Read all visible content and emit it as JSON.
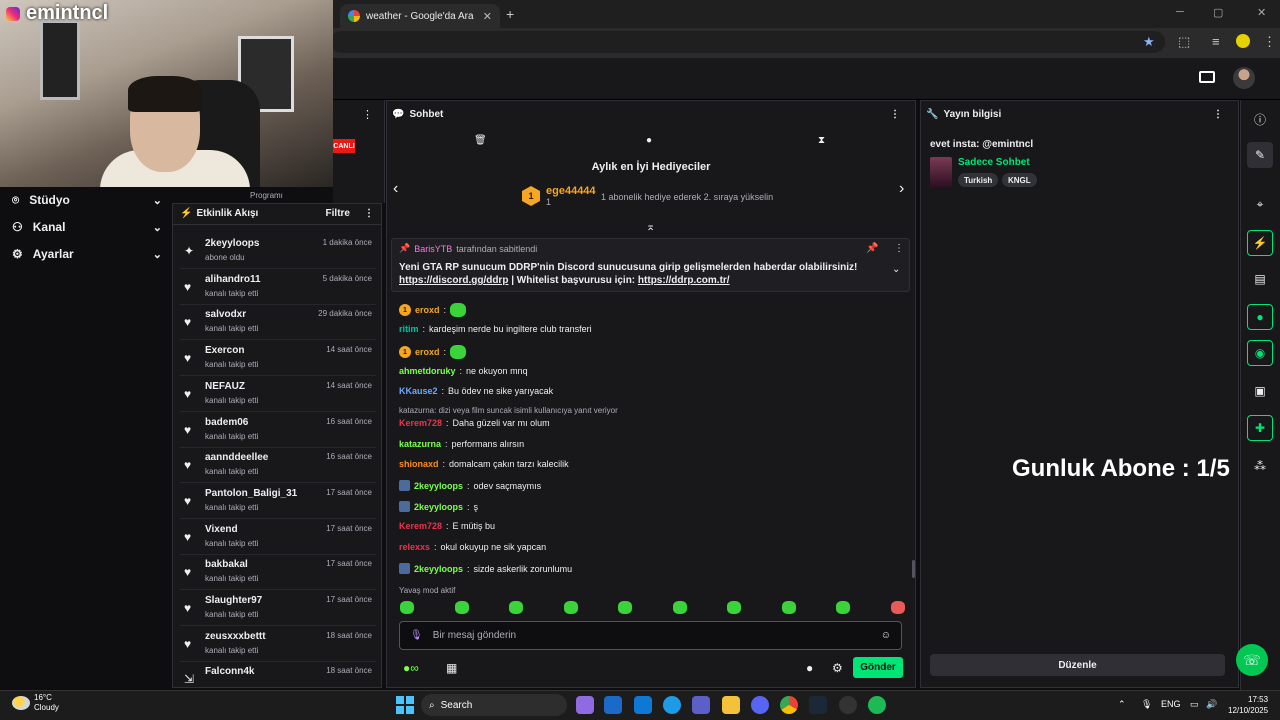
{
  "browser": {
    "tab_title": "weather - Google'da Ara",
    "tab_close": "✕",
    "new_tab": "+",
    "bookmark_star": "★",
    "win_controls": [
      "─",
      "▢",
      "✕"
    ]
  },
  "webcam": {
    "channel_name": "emintncl"
  },
  "left_nav": {
    "items": [
      {
        "icon": "studio-icon",
        "label": "Stüdyo"
      },
      {
        "icon": "channel-icon",
        "label": "Kanal"
      },
      {
        "icon": "settings-icon",
        "label": "Ayarlar"
      }
    ]
  },
  "sliver": {
    "live_badge": "CANLI",
    "text_fragments": [
      "Programı"
    ]
  },
  "activity_feed": {
    "title": "Etkinlik Akışı",
    "filter_label": "Filtre",
    "items": [
      {
        "icon": "star-icon",
        "name": "2keyyloops",
        "action": "abone oldu",
        "time": "1 dakika önce"
      },
      {
        "icon": "heart-icon",
        "name": "alihandro11",
        "action": "kanalı takip etti",
        "time": "5 dakika önce"
      },
      {
        "icon": "heart-icon",
        "name": "salvodxr",
        "action": "kanalı takip etti",
        "time": "29 dakika önce"
      },
      {
        "icon": "heart-icon",
        "name": "Exercon",
        "action": "kanalı takip etti",
        "time": "14 saat önce"
      },
      {
        "icon": "heart-icon",
        "name": "NEFAUZ",
        "action": "kanalı takip etti",
        "time": "14 saat önce"
      },
      {
        "icon": "heart-icon",
        "name": "badem06",
        "action": "kanalı takip etti",
        "time": "16 saat önce"
      },
      {
        "icon": "heart-icon",
        "name": "aannddeellee",
        "action": "kanalı takip etti",
        "time": "16 saat önce"
      },
      {
        "icon": "heart-icon",
        "name": "Pantolon_Baligi_31",
        "action": "kanalı takip etti",
        "time": "17 saat önce"
      },
      {
        "icon": "heart-icon",
        "name": "Vixend",
        "action": "kanalı takip etti",
        "time": "17 saat önce"
      },
      {
        "icon": "heart-icon",
        "name": "bakbakal",
        "action": "kanalı takip etti",
        "time": "17 saat önce"
      },
      {
        "icon": "heart-icon",
        "name": "Slaughter97",
        "action": "kanalı takip etti",
        "time": "17 saat önce"
      },
      {
        "icon": "heart-icon",
        "name": "zeusxxxbettt",
        "action": "kanalı takip etti",
        "time": "18 saat önce"
      },
      {
        "icon": "raid-icon",
        "name": "Falconn4k",
        "action": "",
        "time": "18 saat önce"
      }
    ]
  },
  "chat": {
    "title": "Sohbet",
    "top_gifters": {
      "title": "Aylık en İyi Hediyeciler",
      "rank": "1",
      "name": "ege44444",
      "count": "1",
      "note": "1 abonelik hediye ederek 2. sıraya yükselin"
    },
    "pinned": {
      "pinned_by": "BarisYTB",
      "pinned_suffix": "tarafından sabitlendi",
      "line1": "Yeni GTA RP sunucum DDRP'nin Discord sunucusuna girip gelişmelerden haberdar olabilirsiniz!",
      "link1": "https://discord.gg/ddrp",
      "separator": " | Whitelist başvurusu için: ",
      "link2": "https://ddrp.com.tr/"
    },
    "messages": [
      {
        "user": "eroxd",
        "color": "#f5a623",
        "text": "",
        "emote": true,
        "badge": "sub"
      },
      {
        "user": "ritim",
        "color": "#00bfa5",
        "text": "kardeşim nerde bu ingiltere club transferi",
        "emote": false,
        "badge": ""
      },
      {
        "user": "eroxd",
        "color": "#f5a623",
        "text": "",
        "emote": true,
        "badge": "sub"
      },
      {
        "user": "ahmetdoruky",
        "color": "#7cff4f",
        "text": "ne okuyon mnq",
        "emote": false,
        "badge": ""
      },
      {
        "user": "KKause2",
        "color": "#6aa8ff",
        "text": "Bu ödev ne sike yarıyacak",
        "emote": false,
        "badge": ""
      },
      {
        "user": "Kerem728",
        "color": "#e8354a",
        "text": "Daha güzeli var mı olum",
        "emote": false,
        "badge": ""
      },
      {
        "user": "katazurna",
        "color": "#7cff4f",
        "text": "performans alırsın",
        "emote": false,
        "badge": ""
      },
      {
        "user": "shionaxd",
        "color": "#ff8c1a",
        "text": "domalcam çakın tarzı kalecilik",
        "emote": false,
        "badge": ""
      },
      {
        "user": "2keyyloops",
        "color": "#7cff4f",
        "text": "odev saçmaymıs",
        "emote": false,
        "badge": "mod"
      },
      {
        "user": "2keyyloops",
        "color": "#7cff4f",
        "text": "ş",
        "emote": false,
        "badge": "mod"
      },
      {
        "user": "Kerem728",
        "color": "#e8354a",
        "text": "E mütiş bu",
        "emote": false,
        "badge": ""
      },
      {
        "user": "relexxs",
        "color": "#e8354a",
        "text": "okul okuyup ne sik yapcan",
        "emote": false,
        "badge": ""
      },
      {
        "user": "2keyyloops",
        "color": "#7cff4f",
        "text": "sizde askerlik zorunlumu",
        "emote": false,
        "badge": "mod"
      }
    ],
    "reply_context": "katazurna: dizi veya film suncak isimli kullanıcıya yanıt veriyor",
    "slow_mode": "Yavaş mod aktif",
    "input_placeholder": "Bir mesaj gönderin",
    "send_label": "Gönder"
  },
  "stream_info": {
    "title": "Yayın bilgisi",
    "stream_title": "evet insta: @emintncl",
    "category": "Sadece Sohbet",
    "tags": [
      "Turkish",
      "KNGL"
    ],
    "overlay_text": "Gunluk Abone : 1/5",
    "edit_label": "Düzenle"
  },
  "taskbar": {
    "temp": "16°C",
    "condition": "Cloudy",
    "search_label": "Search",
    "lang": "ENG",
    "time": "17:53",
    "date": "12/10/2025"
  }
}
